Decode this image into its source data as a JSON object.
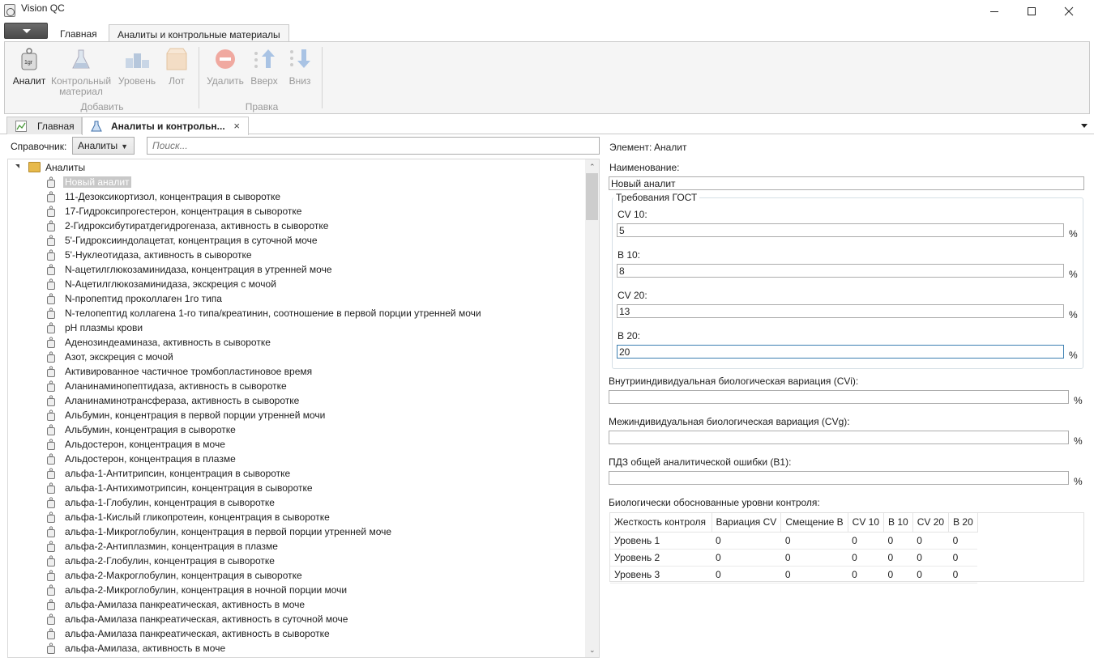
{
  "window": {
    "title": "Vision QC"
  },
  "ribbon_tabs": [
    "Главная",
    "Аналиты и контрольные материалы"
  ],
  "ribbon": {
    "add_group": "Добавить",
    "edit_group": "Правка",
    "buttons": {
      "analyte": "Аналит",
      "control_material_1": "Контрольный",
      "control_material_2": "материал",
      "level": "Уровень",
      "lot": "Лот",
      "delete": "Удалить",
      "up": "Вверх",
      "down": "Вниз"
    }
  },
  "doc_tabs": {
    "home": "Главная",
    "analytes": "Аналиты и контрольн...",
    "close": "×"
  },
  "left": {
    "directory_label": "Справочник:",
    "directory_value": "Аналиты",
    "search_placeholder": "Поиск...",
    "tree_root": "Аналиты",
    "items": [
      "Новый аналит",
      "11-Дезоксикортизол, концентрация в сыворотке",
      "17-Гидроксипрогестерон, концентрация в сыворотке",
      "2-Гидроксибутиратдегидрогеназа, активность в сыворотке",
      "5'-Гидроксииндолацетат, концентрация в суточной моче",
      "5'-Нуклеотидаза, активность в сыворотке",
      "N-ацетилглюкозаминидаза, концентрация в утренней моче",
      "N-Ацетилглюкозаминидаза, экскреция с мочой",
      "N-пропептид проколлаген 1го типа",
      "N-телопептид коллагена 1-го  типа/креатинин, соотношение в первой порции утренней мочи",
      "pH плазмы крови",
      "Аденозиндеаминаза, активность в сыворотке",
      "Азот, экскреция с мочой",
      "Активированное частичное тромбопластиновое время",
      "Аланинаминопептидаза, активность в сыворотке",
      "Аланинаминотрансфераза, активность в сыворотке",
      "Альбумин, концентрация в первой порции утренней мочи",
      "Альбумин, концентрация в сыворотке",
      "Альдостерон, концентрация в моче",
      "Альдостерон, концентрация в плазме",
      "альфа-1-Антитрипсин, концентрация в сыворотке",
      "альфа-1-Антихимотрипсин, концентрация в сыворотке",
      "альфа-1-Глобулин, концентрация в сыворотке",
      "альфа-1-Кислый гликопротеин, концентрация в сыворотке",
      "альфа-1-Микроглобулин, концентрация в первой порции утренней моче",
      "альфа-2-Антиплазмин, концентрация в плазме",
      "альфа-2-Глобулин, концентрация в сыворотке",
      "альфа-2-Макроглобулин, концентрация в сыворотке",
      "альфа-2-Микроглобулин, концентрация в ночной порции мочи",
      "альфа-Амилаза панкреатическая, активность в моче",
      "альфа-Амилаза панкреатическая, активность в суточной моче",
      "альфа-Амилаза панкреатическая, активность в сыворотке",
      "альфа-Амилаза, активность в моче"
    ]
  },
  "right": {
    "element_label": "Элемент:",
    "element_value": "Аналит",
    "name_label": "Наименование:",
    "name_value": "Новый аналит",
    "gost_title": "Требования ГОСТ",
    "cv10_label": "CV 10:",
    "cv10_value": "5",
    "b10_label": "B 10:",
    "b10_value": "8",
    "cv20_label": "CV 20:",
    "cv20_value": "13",
    "b20_label": "B 20:",
    "b20_value": "20",
    "percent": "%",
    "cvi_label": "Внутрииндивидуальная биологическая вариация (CVi):",
    "cvg_label": "Межиндивидуальная биологическая вариация (CVg):",
    "pdz_label": "ПДЗ общей аналитической ошибки (B1):",
    "levels_title": "Биологически обоснованные уровни контроля:",
    "table": {
      "columns": [
        "Жесткость контроля",
        "Вариация CV",
        "Смещение B",
        "CV 10",
        "B 10",
        "CV 20",
        "B 20"
      ],
      "rows": [
        [
          "Уровень 1",
          "0",
          "0",
          "0",
          "0",
          "0",
          "0"
        ],
        [
          "Уровень 2",
          "0",
          "0",
          "0",
          "0",
          "0",
          "0"
        ],
        [
          "Уровень 3",
          "0",
          "0",
          "0",
          "0",
          "0",
          "0"
        ]
      ]
    }
  }
}
